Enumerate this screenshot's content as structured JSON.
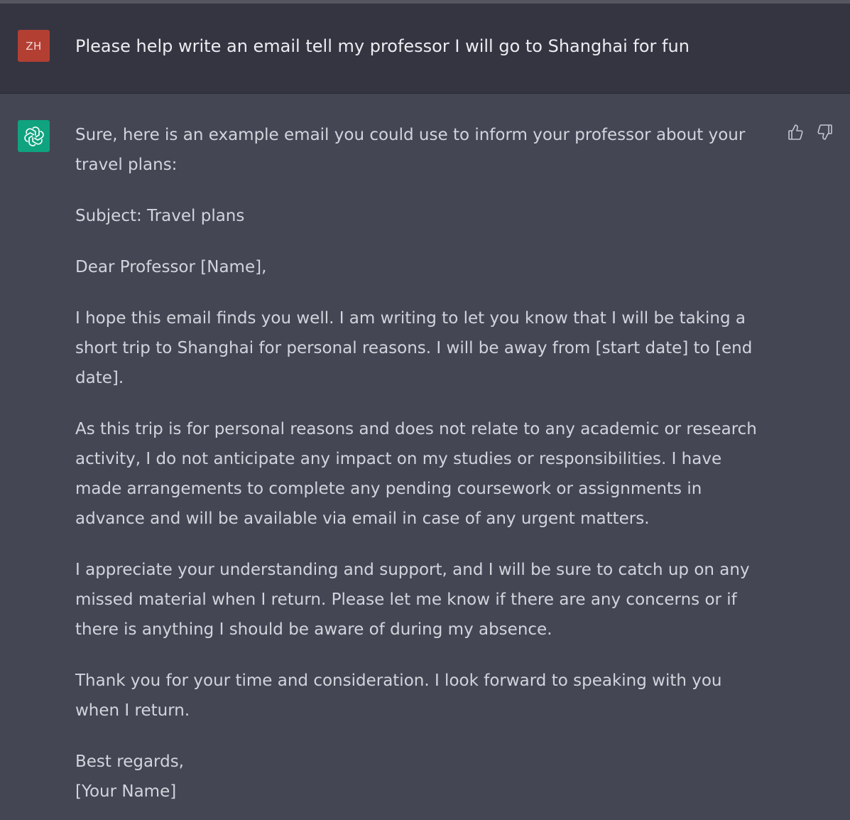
{
  "user_message": {
    "avatar_initials": "ZH",
    "avatar_color": "#b33f33",
    "text": "Please help write an email tell my professor I will go to Shanghai for fun"
  },
  "assistant_message": {
    "avatar_icon": "openai-logo-icon",
    "avatar_color": "#10a37f",
    "paragraphs": [
      "Sure, here is an example email you could use to inform your professor about your travel plans:",
      "Subject: Travel plans",
      "Dear Professor [Name],",
      "I hope this email finds you well. I am writing to let you know that I will be taking a short trip to Shanghai for personal reasons. I will be away from [start date] to [end date].",
      "As this trip is for personal reasons and does not relate to any academic or research activity, I do not anticipate any impact on my studies or responsibilities. I have made arrangements to complete any pending coursework or assignments in advance and will be available via email in case of any urgent matters.",
      "I appreciate your understanding and support, and I will be sure to catch up on any missed material when I return. Please let me know if there are any concerns or if there is anything I should be aware of during my absence.",
      "Thank you for your time and consideration. I look forward to speaking with you when I return."
    ],
    "closing_line_1": "Best regards,",
    "closing_line_2": "[Your Name]"
  },
  "feedback": {
    "thumbs_up_icon": "thumbs-up-icon",
    "thumbs_down_icon": "thumbs-down-icon"
  },
  "colors": {
    "user_bg": "#343541",
    "assistant_bg": "#444654",
    "text": "#d1d5db"
  }
}
